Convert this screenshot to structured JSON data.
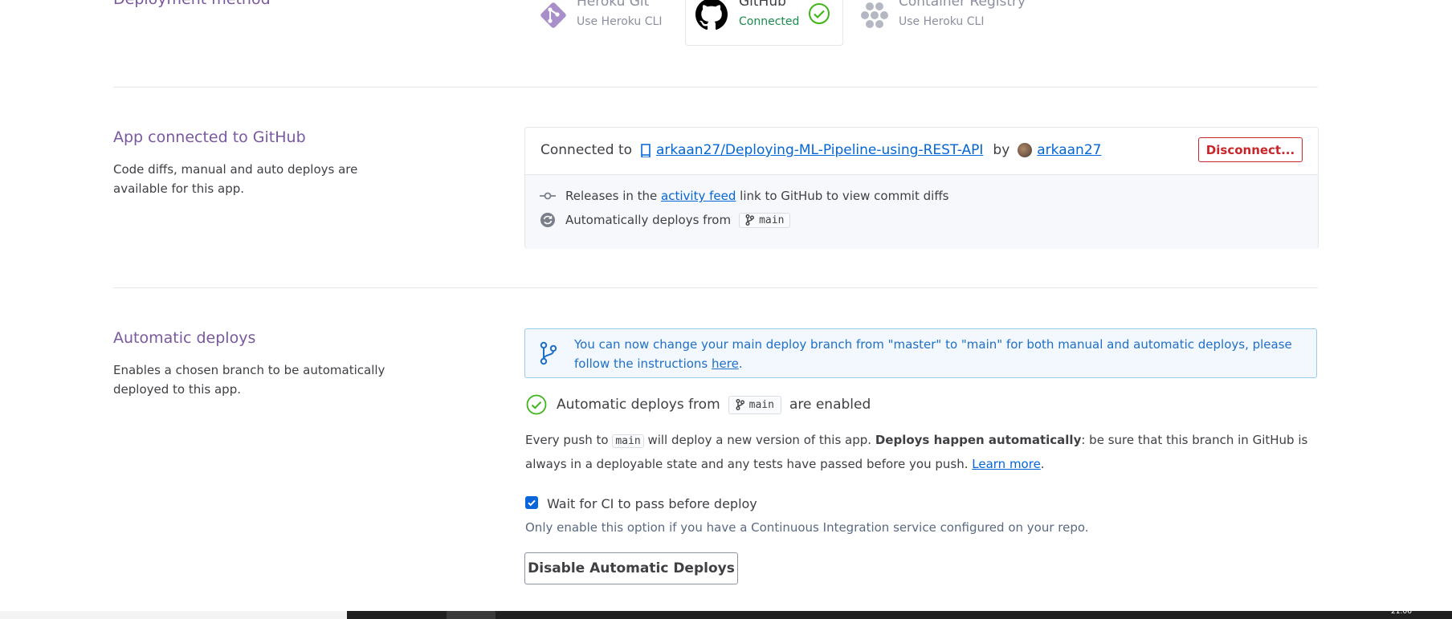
{
  "deployment_method": {
    "section_title": "Deployment method",
    "methods": [
      {
        "title": "Heroku Git",
        "subtitle": "Use Heroku CLI"
      },
      {
        "title": "GitHub",
        "subtitle": "Connected"
      },
      {
        "title": "Container Registry",
        "subtitle": "Use Heroku CLI"
      }
    ]
  },
  "connected_section": {
    "title": "App connected to GitHub",
    "description": "Code diffs, manual and auto deploys are available for this app.",
    "connected_prefix": "Connected to",
    "repo": "arkaan27/Deploying-ML-Pipeline-using-REST-API",
    "by_label": "by",
    "user": "arkaan27",
    "disconnect_label": "Disconnect...",
    "releases_prefix": "Releases in the",
    "activity_feed_link": "activity feed",
    "releases_suffix": "link to GitHub to view commit diffs",
    "auto_deploys_prefix": "Automatically deploys from",
    "branch": "main"
  },
  "automatic_section": {
    "title": "Automatic deploys",
    "description": "Enables a chosen branch to be automatically deployed to this app.",
    "info_text": "You can now change your main deploy branch from \"master\" to \"main\" for both manual and automatic deploys, please follow the instructions",
    "info_link": "here",
    "info_period": ".",
    "status_prefix": "Automatic deploys from",
    "status_branch": "main",
    "status_suffix": "are enabled",
    "push_prefix": "Every push to",
    "push_branch": "main",
    "push_mid": "will deploy a new version of this app.",
    "push_bold": "Deploys happen automatically",
    "push_rest": ": be sure that this branch in GitHub is always in a deployable state and any tests have passed before you push.",
    "learn_more": "Learn more",
    "learn_more_period": ".",
    "ci_checkbox_label": "Wait for CI to pass before deploy",
    "ci_checked": true,
    "ci_hint": "Only enable this option if you have a Continuous Integration service configured on your repo.",
    "disable_button": "Disable Automatic Deploys"
  },
  "colors": {
    "heroku_purple": "#79589f",
    "link_blue": "#0366d6",
    "danger_red": "#c9262c",
    "success_green": "#3fb618"
  },
  "taskbar_clock": "21:06"
}
